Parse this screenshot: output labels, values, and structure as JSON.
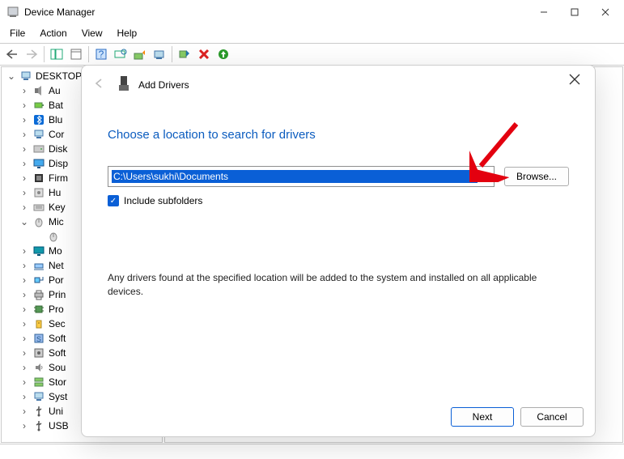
{
  "window": {
    "title": "Device Manager"
  },
  "menu": {
    "file": "File",
    "action": "Action",
    "view": "View",
    "help": "Help"
  },
  "tree": {
    "root": "DESKTOP",
    "items": [
      {
        "label": "Audio",
        "icon": "speaker"
      },
      {
        "label": "Batteries",
        "icon": "battery"
      },
      {
        "label": "Bluetooth",
        "icon": "bt"
      },
      {
        "label": "Computer",
        "icon": "computer"
      },
      {
        "label": "Disk drives",
        "icon": "disk"
      },
      {
        "label": "Display adapters",
        "icon": "display"
      },
      {
        "label": "Firmware",
        "icon": "firmware"
      },
      {
        "label": "Human Interface",
        "icon": "hid"
      },
      {
        "label": "Keyboards",
        "icon": "keyboard"
      },
      {
        "label": "Mice",
        "icon": "mouse",
        "expanded": true
      },
      {
        "label": "Monitors",
        "icon": "monitor"
      },
      {
        "label": "Network",
        "icon": "net"
      },
      {
        "label": "Ports",
        "icon": "port"
      },
      {
        "label": "Print queues",
        "icon": "printer"
      },
      {
        "label": "Processors",
        "icon": "cpu"
      },
      {
        "label": "Security",
        "icon": "security"
      },
      {
        "label": "Software components",
        "icon": "swc"
      },
      {
        "label": "Software devices",
        "icon": "swd"
      },
      {
        "label": "Sound",
        "icon": "sound"
      },
      {
        "label": "Storage",
        "icon": "storage"
      },
      {
        "label": "System",
        "icon": "system"
      },
      {
        "label": "Universal",
        "icon": "usb"
      },
      {
        "label": "USB",
        "icon": "usb"
      }
    ],
    "child": "HID-compliant mouse"
  },
  "dialog": {
    "title": "Add Drivers",
    "heading": "Choose a location to search for drivers",
    "path": "C:\\Users\\sukhi\\Documents",
    "browse": "Browse...",
    "include": "Include subfolders",
    "info": "Any drivers found at the specified location will be added to the system and installed on all applicable devices.",
    "next": "Next",
    "cancel": "Cancel"
  }
}
